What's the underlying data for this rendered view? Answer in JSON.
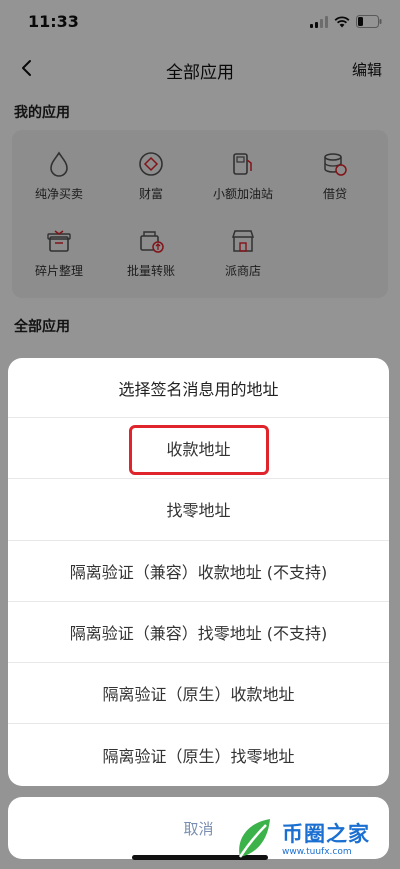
{
  "status_bar": {
    "time": "11:33"
  },
  "nav": {
    "title": "全部应用",
    "edit_label": "编辑"
  },
  "my_apps": {
    "section_title": "我的应用",
    "items": [
      {
        "label": "纯净买卖",
        "icon": "drop-icon"
      },
      {
        "label": "财富",
        "icon": "diamond-coin-icon"
      },
      {
        "label": "小额加油站",
        "icon": "fuel-station-icon"
      },
      {
        "label": "借贷",
        "icon": "coin-stack-icon"
      },
      {
        "label": "碎片整理",
        "icon": "package-icon"
      },
      {
        "label": "批量转账",
        "icon": "batch-transfer-icon"
      },
      {
        "label": "派商店",
        "icon": "store-icon"
      }
    ]
  },
  "all_apps": {
    "section_title": "全部应用"
  },
  "sheet": {
    "title": "选择签名消息用的地址",
    "options": [
      "收款地址",
      "找零地址",
      "隔离验证（兼容）收款地址 (不支持)",
      "隔离验证（兼容）找零地址 (不支持)",
      "隔离验证（原生）收款地址",
      "隔离验证（原生）找零地址"
    ],
    "cancel_label": "取消"
  },
  "watermark": {
    "name": "币圈之家",
    "url": "www.tuufx.com"
  },
  "colors": {
    "highlight": "#e0242b",
    "cancel_text": "#7a8fb0",
    "watermark": "#1a6fd1"
  }
}
